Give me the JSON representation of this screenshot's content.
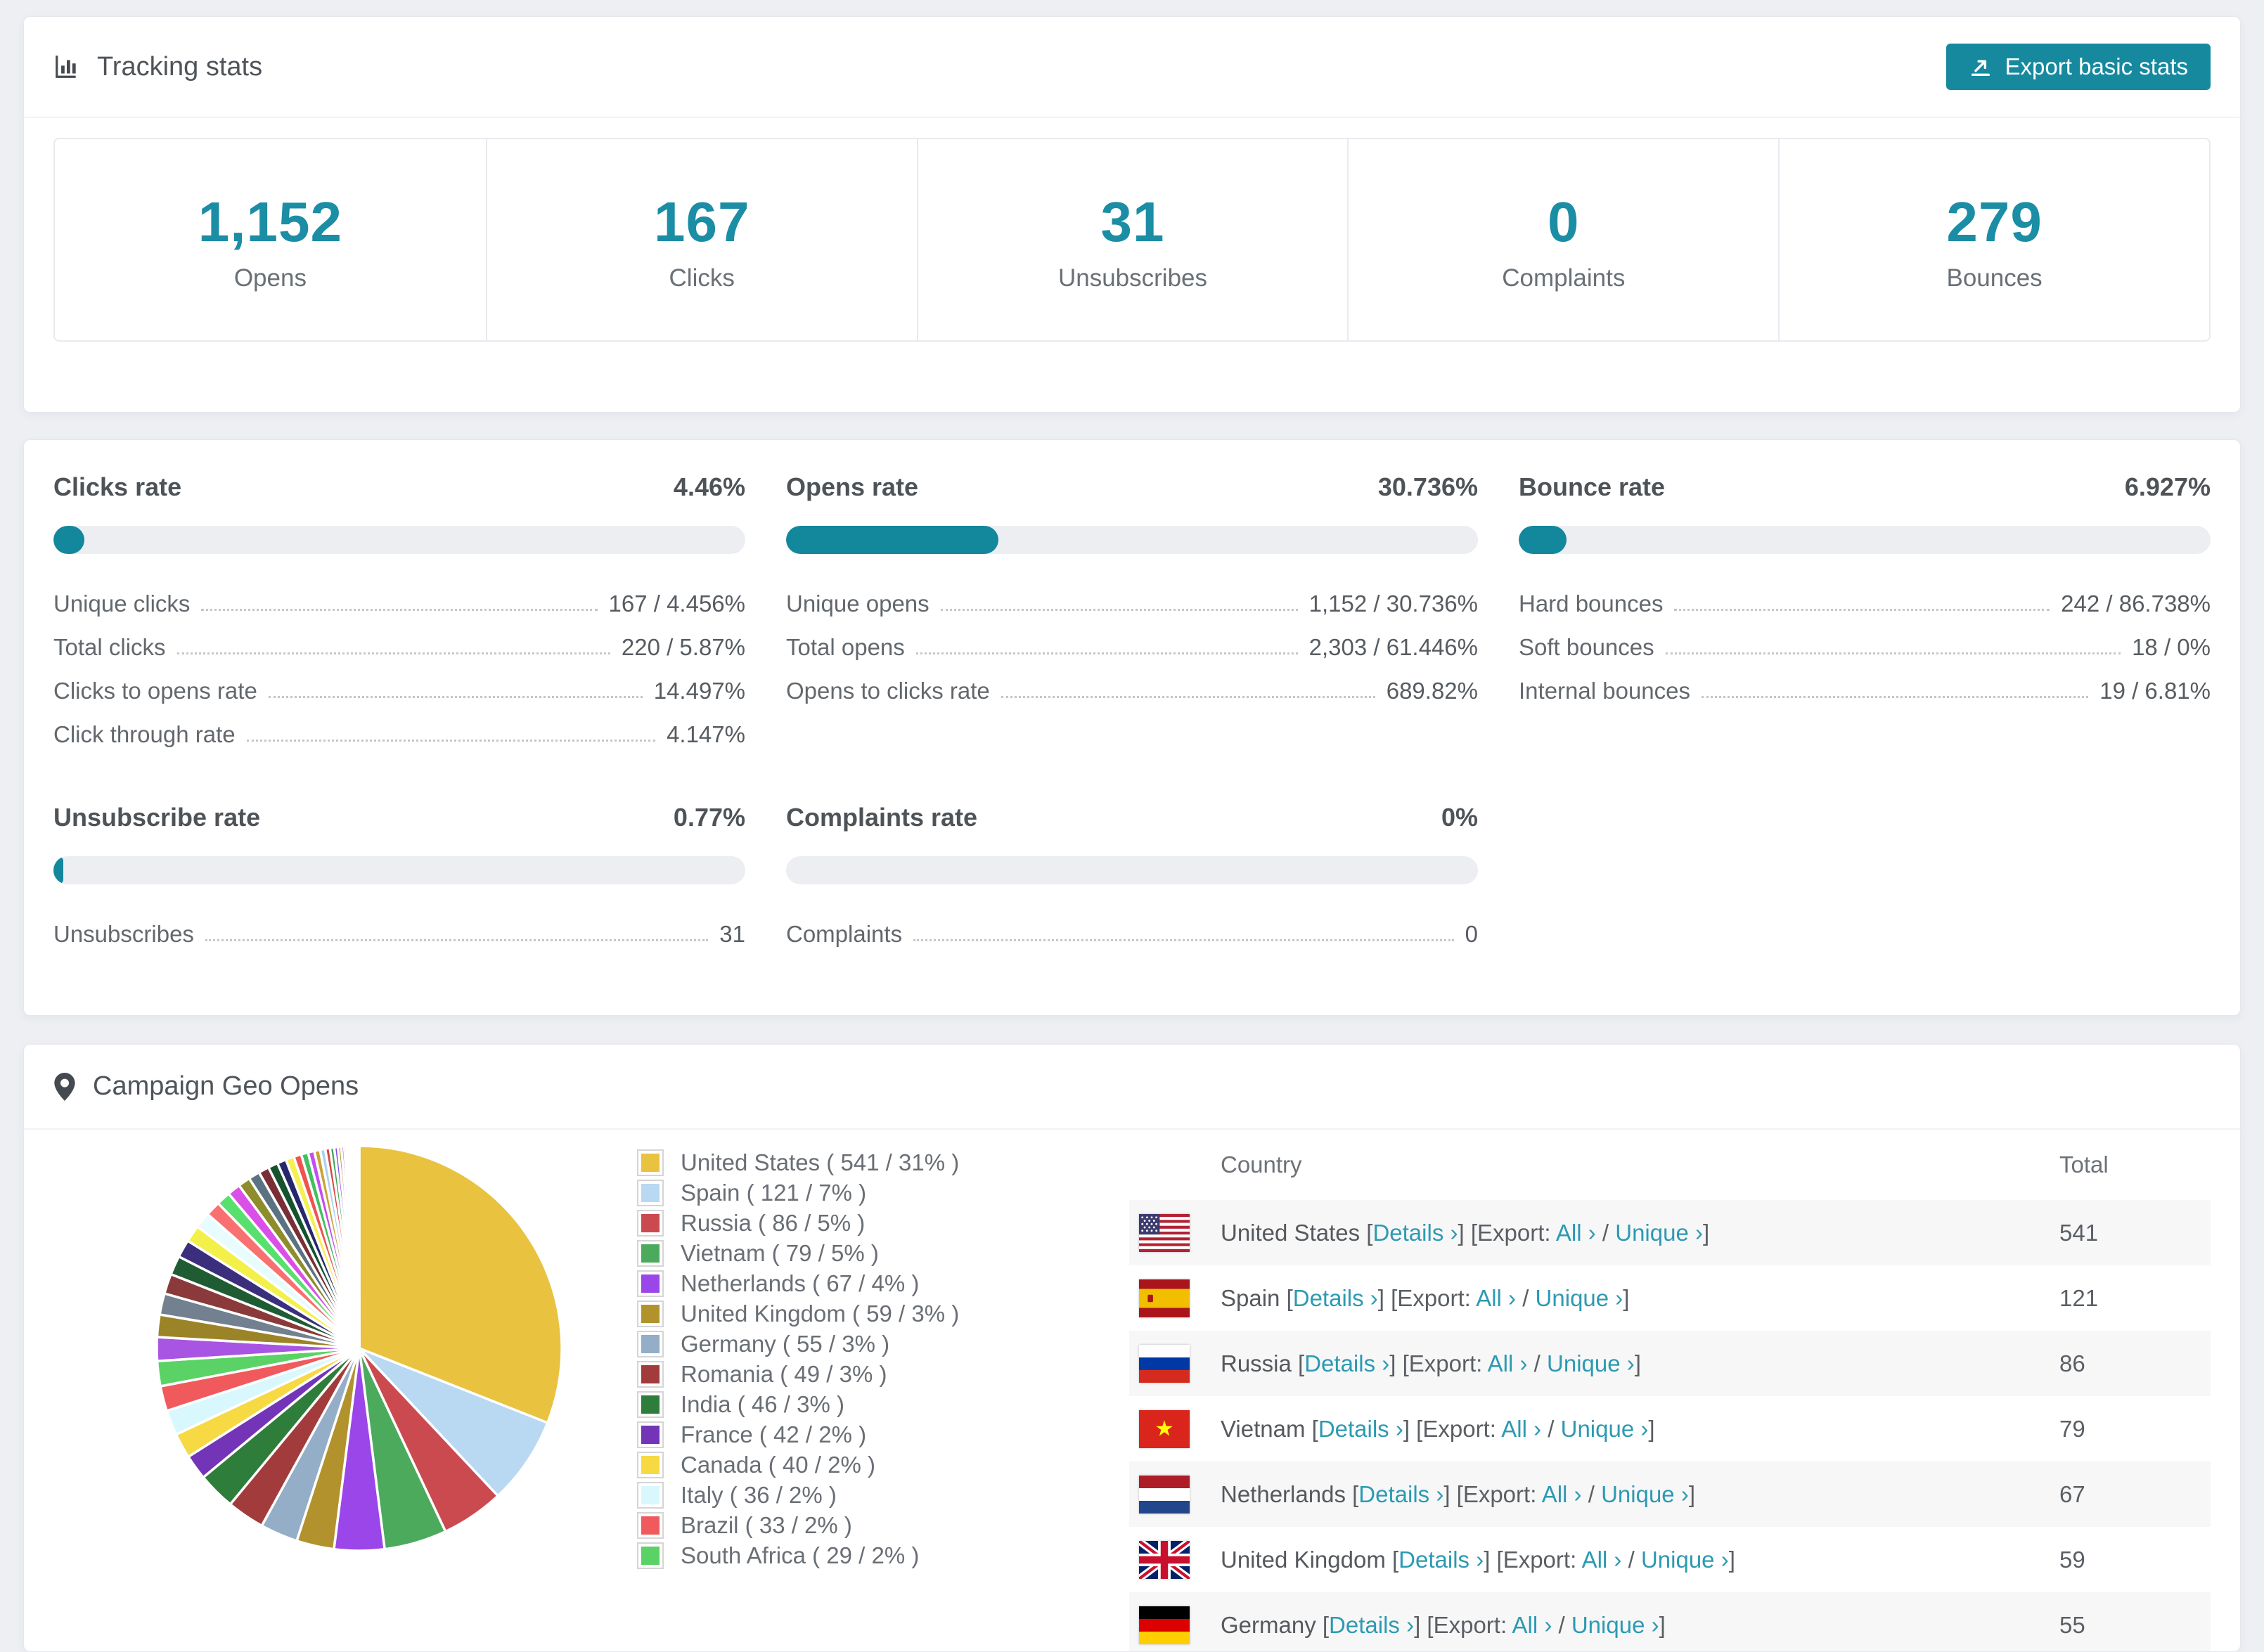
{
  "colors": {
    "accent_teal": "#17899e",
    "stat_number": "#1b8da4",
    "link": "#2d9ab2",
    "bar_track": "#eceef2",
    "row_stripe": "#f7f7f8"
  },
  "tracking": {
    "title": "Tracking stats",
    "export_button": "Export basic stats",
    "stats": [
      {
        "value": "1,152",
        "label": "Opens"
      },
      {
        "value": "167",
        "label": "Clicks"
      },
      {
        "value": "31",
        "label": "Unsubscribes"
      },
      {
        "value": "0",
        "label": "Complaints"
      },
      {
        "value": "279",
        "label": "Bounces"
      }
    ]
  },
  "rates": [
    {
      "title": "Clicks rate",
      "value": "4.46%",
      "pct": 4.46,
      "rows": [
        [
          "Unique clicks",
          "167 / 4.456%"
        ],
        [
          "Total clicks",
          "220 / 5.87%"
        ],
        [
          "Clicks to opens rate",
          "14.497%"
        ],
        [
          "Click through rate",
          "4.147%"
        ]
      ]
    },
    {
      "title": "Opens rate",
      "value": "30.736%",
      "pct": 30.736,
      "rows": [
        [
          "Unique opens",
          "1,152 / 30.736%"
        ],
        [
          "Total opens",
          "2,303 / 61.446%"
        ],
        [
          "Opens to clicks rate",
          "689.82%"
        ]
      ]
    },
    {
      "title": "Bounce rate",
      "value": "6.927%",
      "pct": 6.927,
      "rows": [
        [
          "Hard bounces",
          "242 / 86.738%"
        ],
        [
          "Soft bounces",
          "18 / 0%"
        ],
        [
          "Internal bounces",
          "19 / 6.81%"
        ]
      ]
    },
    {
      "title": "Unsubscribe rate",
      "value": "0.77%",
      "pct": 0.77,
      "rows": [
        [
          "Unsubscribes",
          "31"
        ]
      ]
    },
    {
      "title": "Complaints rate",
      "value": "0%",
      "pct": 0,
      "rows": [
        [
          "Complaints",
          "0"
        ]
      ]
    }
  ],
  "geo": {
    "title": "Campaign Geo Opens",
    "table": {
      "headers": [
        "Country",
        "Total"
      ],
      "link_details": "Details",
      "label_export": "Export:",
      "link_all": "All",
      "link_unique": "Unique",
      "chevron": "›",
      "rows": [
        {
          "country": "United States",
          "flag": "us",
          "total": "541"
        },
        {
          "country": "Spain",
          "flag": "es",
          "total": "121"
        },
        {
          "country": "Russia",
          "flag": "ru",
          "total": "86"
        },
        {
          "country": "Vietnam",
          "flag": "vn",
          "total": "79"
        },
        {
          "country": "Netherlands",
          "flag": "nl",
          "total": "67"
        },
        {
          "country": "United Kingdom",
          "flag": "gb",
          "total": "59"
        },
        {
          "country": "Germany",
          "flag": "de",
          "total": "55"
        }
      ]
    }
  },
  "chart_data": {
    "type": "pie",
    "title": "Campaign Geo Opens",
    "legend_position": "right",
    "start": "top",
    "direction": "clockwise",
    "slices": [
      {
        "label": "United States",
        "value": 541,
        "pct": 31,
        "color": "#e9c23f"
      },
      {
        "label": "Spain",
        "value": 121,
        "pct": 7,
        "color": "#b9d8f2"
      },
      {
        "label": "Russia",
        "value": 86,
        "pct": 5,
        "color": "#cb4a50"
      },
      {
        "label": "Vietnam",
        "value": 79,
        "pct": 5,
        "color": "#4caa5c"
      },
      {
        "label": "Netherlands",
        "value": 67,
        "pct": 4,
        "color": "#9a46e8"
      },
      {
        "label": "United Kingdom",
        "value": 59,
        "pct": 3,
        "color": "#b2922c"
      },
      {
        "label": "Germany",
        "value": 55,
        "pct": 3,
        "color": "#93aec6"
      },
      {
        "label": "Romania",
        "value": 49,
        "pct": 3,
        "color": "#a23c3c"
      },
      {
        "label": "India",
        "value": 46,
        "pct": 3,
        "color": "#2f7d3b"
      },
      {
        "label": "France",
        "value": 42,
        "pct": 2,
        "color": "#7334b8"
      },
      {
        "label": "Canada",
        "value": 40,
        "pct": 2,
        "color": "#f6d943"
      },
      {
        "label": "Italy",
        "value": 36,
        "pct": 2,
        "color": "#d9f8fd"
      },
      {
        "label": "Brazil",
        "value": 33,
        "pct": 2,
        "color": "#f05a5c"
      },
      {
        "label": "South Africa",
        "value": 29,
        "pct": 2,
        "color": "#5bd266"
      }
    ],
    "others_tail": {
      "note": "many small unlabeled countries filling the rest of the pie",
      "percent_total": 26,
      "count": 40,
      "palette": [
        "#a855e3",
        "#9b8427",
        "#72808f",
        "#8a3a3a",
        "#1f5c33",
        "#3b2f7d",
        "#f3f04a",
        "#e8fbfd",
        "#f87070",
        "#57e06e",
        "#d94fe8",
        "#8d8d2b",
        "#5b7282",
        "#7a2e35",
        "#14532d",
        "#27276e",
        "#f5ef52",
        "#ef5350",
        "#43bf61",
        "#c44df0",
        "#caa236",
        "#a8d4f2",
        "#d9453e",
        "#3da553",
        "#8a4fe8",
        "#b5952f"
      ]
    }
  }
}
